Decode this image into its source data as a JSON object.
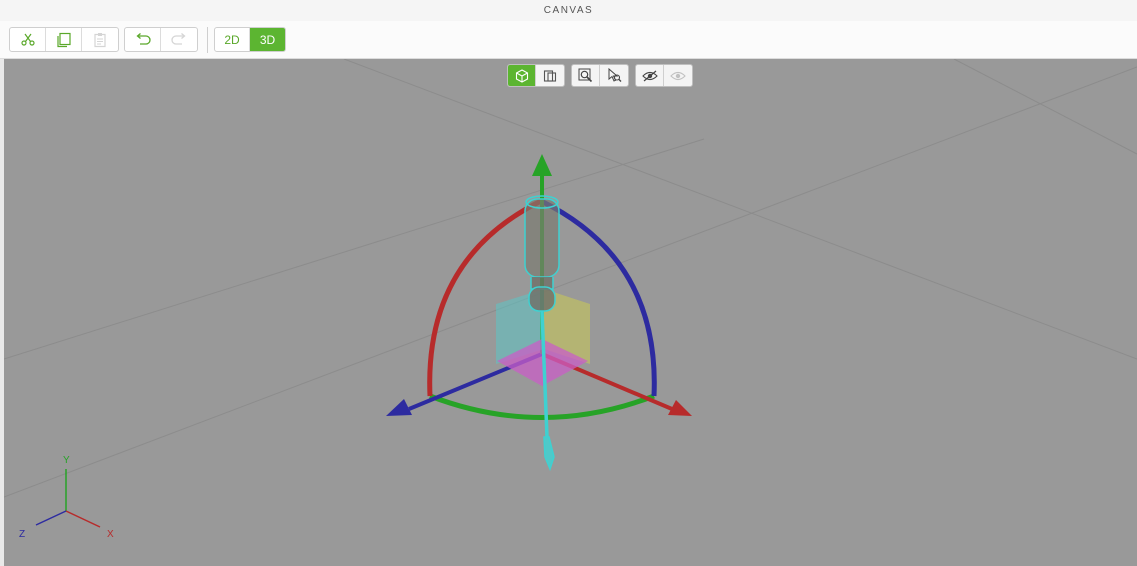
{
  "header": {
    "title": "CANVAS"
  },
  "toolbar": {
    "edit_icons": [
      "scissors-icon",
      "duplicate-icon",
      "paste-icon"
    ],
    "history_icons": [
      "undo-icon",
      "redo-icon"
    ],
    "mode_2d": "2D",
    "mode_3d": "3D",
    "active_mode": "3D"
  },
  "viewport_toolbar": {
    "view_icons": [
      "cube-view-icon",
      "panel-view-icon"
    ],
    "zoom_icons": [
      "zoom-fit-icon",
      "zoom-select-icon"
    ],
    "visibility_icons": [
      "hide-icon",
      "show-icon"
    ]
  },
  "orientation": {
    "x": "X",
    "y": "Y",
    "z": "Z"
  },
  "colors": {
    "accent": "#5cb531",
    "x_axis": "#b72b2b",
    "y_axis": "#27a327",
    "z_axis": "#2d2ba0",
    "viewport_bg": "#999999",
    "object": "#3fd1d1"
  }
}
